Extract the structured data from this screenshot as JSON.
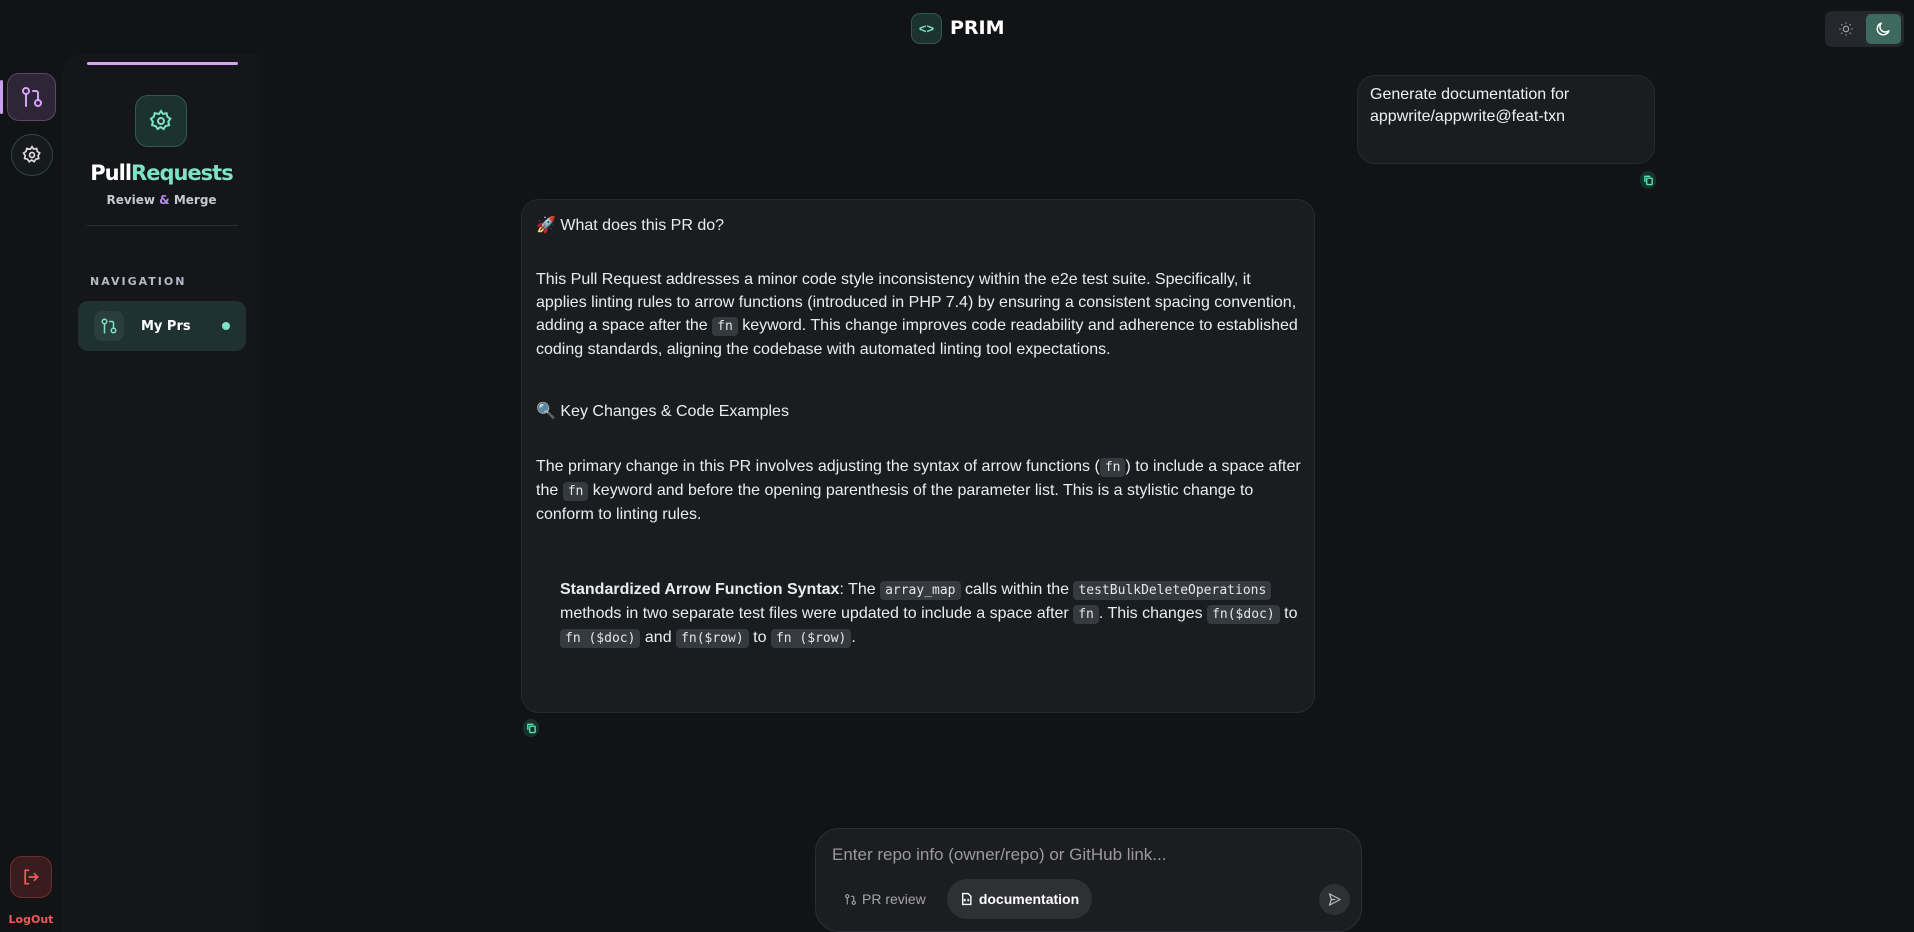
{
  "header": {
    "title": "PRIM",
    "logo_icon": "code-icon"
  },
  "theme_toggle": {
    "options": [
      "light",
      "dark"
    ],
    "selected": "dark"
  },
  "rail": {
    "items": [
      "pull-request",
      "settings"
    ],
    "active": "pull-request",
    "logout_label": "LogOut"
  },
  "sidebar": {
    "brand_part1": "Pull",
    "brand_part2": "Requests",
    "tagline_1": "Review ",
    "tagline_amp": "&",
    "tagline_2": " Merge",
    "nav_heading": "NAVIGATION",
    "nav_items": [
      {
        "label": "My Prs",
        "active": true
      }
    ]
  },
  "chat": {
    "user_message": "Generate documentation for appwrite/appwrite@feat-txn",
    "assistant": {
      "h1_emoji": "🚀",
      "h1": "What does this PR do?",
      "p1_a": "This Pull Request addresses a minor code style inconsistency within the e2e test suite. Specifically, it applies linting rules to arrow functions (introduced in PHP 7.4) by ensuring a consistent spacing convention, adding a space after the ",
      "p1_code": "fn",
      "p1_b": " keyword. This change improves code readability and adherence to established coding standards, aligning the codebase with automated linting tool expectations.",
      "h2_emoji": "🔍",
      "h2": "Key Changes & Code Examples",
      "p2_a": "The primary change in this PR involves adjusting the syntax of arrow functions (",
      "p2_code1": "fn",
      "p2_b": ") to include a space after the ",
      "p2_code2": "fn",
      "p2_c": " keyword and before the opening parenthesis of the parameter list. This is a stylistic change to conform to linting rules.",
      "li_bold": "Standardized Arrow Function Syntax",
      "li_a": ": The ",
      "li_code1": "array_map",
      "li_b": " calls within the ",
      "li_code2": "testBulkDeleteOperations",
      "li_c": " methods in two separate test files were updated to include a space after ",
      "li_code3": "fn",
      "li_d": ". This changes ",
      "li_code4": "fn($doc)",
      "li_e": " to ",
      "li_code5": "fn ($doc)",
      "li_f": " and ",
      "li_code6": "fn($row)",
      "li_g": " to ",
      "li_code7": "fn ($row)",
      "li_h": "."
    }
  },
  "composer": {
    "placeholder": "Enter repo info (owner/repo) or GitHub link...",
    "value": "",
    "modes": [
      {
        "label": "PR review",
        "selected": false
      },
      {
        "label": "documentation",
        "selected": true
      }
    ]
  },
  "colors": {
    "accent": "#7de3c4",
    "purple": "#d6a4f4",
    "danger": "#f05a5a",
    "bg": "#111315"
  }
}
